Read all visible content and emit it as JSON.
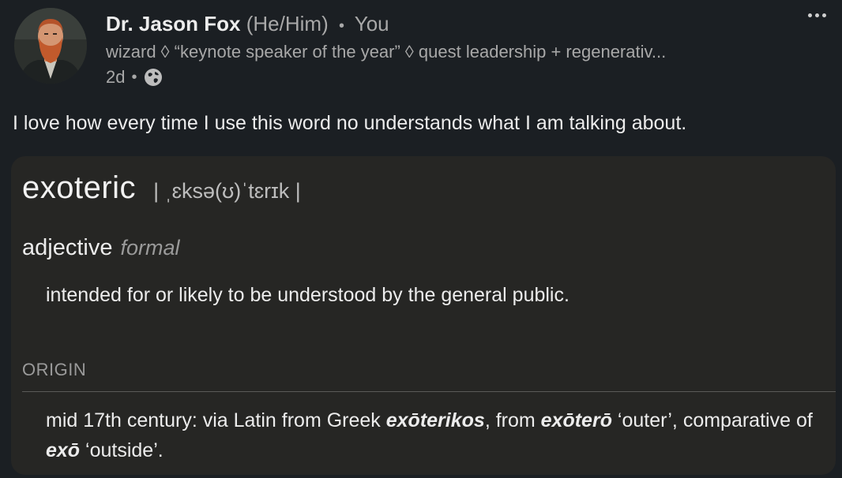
{
  "author": {
    "name": "Dr. Jason Fox",
    "pronouns": "(He/Him)",
    "connection": "You",
    "headline": "wizard ◊ “keynote speaker of the year” ◊ quest leadership + regenerativ...",
    "time": "2d",
    "visibility_icon": "globe-icon",
    "avatar_icon": "avatar"
  },
  "post": {
    "text": "I love how every time I use this word no understands what I am talking about."
  },
  "dictionary": {
    "word": "exoteric",
    "pronunciation": "| ˌɛksə(ʊ)ˈtɛrɪk |",
    "part_of_speech": "adjective",
    "register": "formal",
    "definition": "intended for or likely to be understood by the general public.",
    "origin_label": "ORIGIN",
    "etymology": {
      "part1": "mid 17th century: via Latin from Greek ",
      "term1": "exōterikos",
      "part2": ", from ",
      "term2": "exōterō",
      "part3": " ‘outer’, comparative of ",
      "term3": "exō",
      "part4": " ‘outside’."
    }
  },
  "menu": {
    "more_icon": "more-options-icon"
  },
  "colors": {
    "background": "#1b1f23",
    "card": "#262624",
    "text": "#ececec",
    "muted": "#a8a8a8"
  }
}
